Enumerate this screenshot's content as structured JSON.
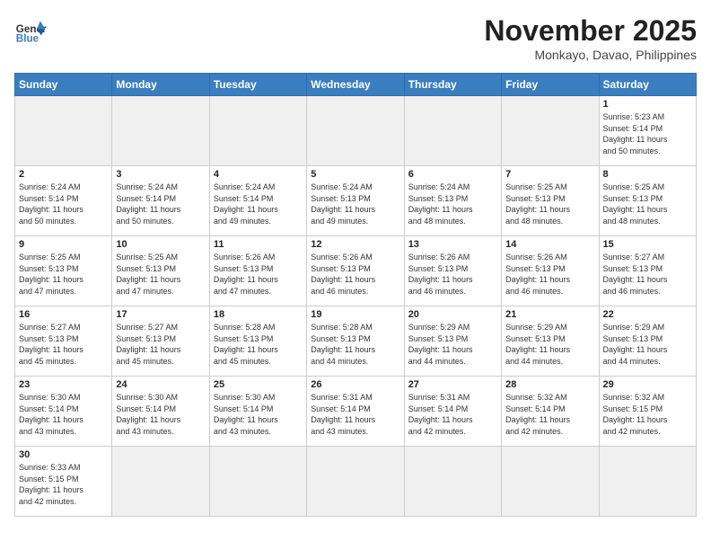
{
  "header": {
    "logo_general": "General",
    "logo_blue": "Blue",
    "month_title": "November 2025",
    "subtitle": "Monkayo, Davao, Philippines"
  },
  "days_of_week": [
    "Sunday",
    "Monday",
    "Tuesday",
    "Wednesday",
    "Thursday",
    "Friday",
    "Saturday"
  ],
  "weeks": [
    [
      {
        "day": "",
        "info": ""
      },
      {
        "day": "",
        "info": ""
      },
      {
        "day": "",
        "info": ""
      },
      {
        "day": "",
        "info": ""
      },
      {
        "day": "",
        "info": ""
      },
      {
        "day": "",
        "info": ""
      },
      {
        "day": "1",
        "info": "Sunrise: 5:23 AM\nSunset: 5:14 PM\nDaylight: 11 hours\nand 50 minutes."
      }
    ],
    [
      {
        "day": "2",
        "info": "Sunrise: 5:24 AM\nSunset: 5:14 PM\nDaylight: 11 hours\nand 50 minutes."
      },
      {
        "day": "3",
        "info": "Sunrise: 5:24 AM\nSunset: 5:14 PM\nDaylight: 11 hours\nand 50 minutes."
      },
      {
        "day": "4",
        "info": "Sunrise: 5:24 AM\nSunset: 5:14 PM\nDaylight: 11 hours\nand 49 minutes."
      },
      {
        "day": "5",
        "info": "Sunrise: 5:24 AM\nSunset: 5:13 PM\nDaylight: 11 hours\nand 49 minutes."
      },
      {
        "day": "6",
        "info": "Sunrise: 5:24 AM\nSunset: 5:13 PM\nDaylight: 11 hours\nand 48 minutes."
      },
      {
        "day": "7",
        "info": "Sunrise: 5:25 AM\nSunset: 5:13 PM\nDaylight: 11 hours\nand 48 minutes."
      },
      {
        "day": "8",
        "info": "Sunrise: 5:25 AM\nSunset: 5:13 PM\nDaylight: 11 hours\nand 48 minutes."
      }
    ],
    [
      {
        "day": "9",
        "info": "Sunrise: 5:25 AM\nSunset: 5:13 PM\nDaylight: 11 hours\nand 47 minutes."
      },
      {
        "day": "10",
        "info": "Sunrise: 5:25 AM\nSunset: 5:13 PM\nDaylight: 11 hours\nand 47 minutes."
      },
      {
        "day": "11",
        "info": "Sunrise: 5:26 AM\nSunset: 5:13 PM\nDaylight: 11 hours\nand 47 minutes."
      },
      {
        "day": "12",
        "info": "Sunrise: 5:26 AM\nSunset: 5:13 PM\nDaylight: 11 hours\nand 46 minutes."
      },
      {
        "day": "13",
        "info": "Sunrise: 5:26 AM\nSunset: 5:13 PM\nDaylight: 11 hours\nand 46 minutes."
      },
      {
        "day": "14",
        "info": "Sunrise: 5:26 AM\nSunset: 5:13 PM\nDaylight: 11 hours\nand 46 minutes."
      },
      {
        "day": "15",
        "info": "Sunrise: 5:27 AM\nSunset: 5:13 PM\nDaylight: 11 hours\nand 46 minutes."
      }
    ],
    [
      {
        "day": "16",
        "info": "Sunrise: 5:27 AM\nSunset: 5:13 PM\nDaylight: 11 hours\nand 45 minutes."
      },
      {
        "day": "17",
        "info": "Sunrise: 5:27 AM\nSunset: 5:13 PM\nDaylight: 11 hours\nand 45 minutes."
      },
      {
        "day": "18",
        "info": "Sunrise: 5:28 AM\nSunset: 5:13 PM\nDaylight: 11 hours\nand 45 minutes."
      },
      {
        "day": "19",
        "info": "Sunrise: 5:28 AM\nSunset: 5:13 PM\nDaylight: 11 hours\nand 44 minutes."
      },
      {
        "day": "20",
        "info": "Sunrise: 5:29 AM\nSunset: 5:13 PM\nDaylight: 11 hours\nand 44 minutes."
      },
      {
        "day": "21",
        "info": "Sunrise: 5:29 AM\nSunset: 5:13 PM\nDaylight: 11 hours\nand 44 minutes."
      },
      {
        "day": "22",
        "info": "Sunrise: 5:29 AM\nSunset: 5:13 PM\nDaylight: 11 hours\nand 44 minutes."
      }
    ],
    [
      {
        "day": "23",
        "info": "Sunrise: 5:30 AM\nSunset: 5:14 PM\nDaylight: 11 hours\nand 43 minutes."
      },
      {
        "day": "24",
        "info": "Sunrise: 5:30 AM\nSunset: 5:14 PM\nDaylight: 11 hours\nand 43 minutes."
      },
      {
        "day": "25",
        "info": "Sunrise: 5:30 AM\nSunset: 5:14 PM\nDaylight: 11 hours\nand 43 minutes."
      },
      {
        "day": "26",
        "info": "Sunrise: 5:31 AM\nSunset: 5:14 PM\nDaylight: 11 hours\nand 43 minutes."
      },
      {
        "day": "27",
        "info": "Sunrise: 5:31 AM\nSunset: 5:14 PM\nDaylight: 11 hours\nand 42 minutes."
      },
      {
        "day": "28",
        "info": "Sunrise: 5:32 AM\nSunset: 5:14 PM\nDaylight: 11 hours\nand 42 minutes."
      },
      {
        "day": "29",
        "info": "Sunrise: 5:32 AM\nSunset: 5:15 PM\nDaylight: 11 hours\nand 42 minutes."
      }
    ],
    [
      {
        "day": "30",
        "info": "Sunrise: 5:33 AM\nSunset: 5:15 PM\nDaylight: 11 hours\nand 42 minutes."
      },
      {
        "day": "",
        "info": ""
      },
      {
        "day": "",
        "info": ""
      },
      {
        "day": "",
        "info": ""
      },
      {
        "day": "",
        "info": ""
      },
      {
        "day": "",
        "info": ""
      },
      {
        "day": "",
        "info": ""
      }
    ]
  ]
}
